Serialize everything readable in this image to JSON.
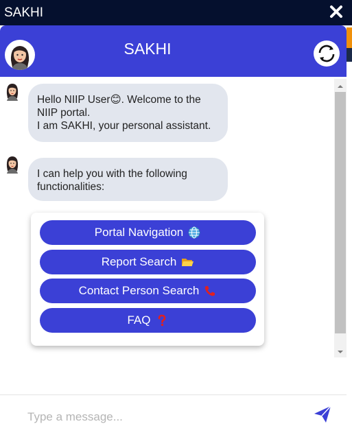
{
  "window": {
    "title": "SAKHI",
    "close_icon": "close-icon"
  },
  "header": {
    "title": "SAKHI",
    "avatar_icon": "assistant-avatar",
    "refresh_icon": "refresh-icon",
    "color": "#3b40d6"
  },
  "messages": [
    {
      "lines": [
        "Hello NIIP User😊. Welcome to the",
        "NIIP portal.",
        "I am SAKHI, your personal assistant."
      ]
    },
    {
      "lines": [
        "I can help you with the following",
        "functionalities:"
      ]
    }
  ],
  "options": [
    {
      "label": "Portal Navigation",
      "emoji": "🌐",
      "icon": "globe-icon"
    },
    {
      "label": "Report Search",
      "emoji": "📂",
      "icon": "folder-icon"
    },
    {
      "label": "Contact Person Search",
      "emoji": "📞",
      "icon": "phone-icon"
    },
    {
      "label": "FAQ",
      "emoji": "❓",
      "icon": "question-mark-icon"
    }
  ],
  "input": {
    "placeholder": "Type a message...",
    "value": "",
    "send_icon": "send-icon"
  }
}
